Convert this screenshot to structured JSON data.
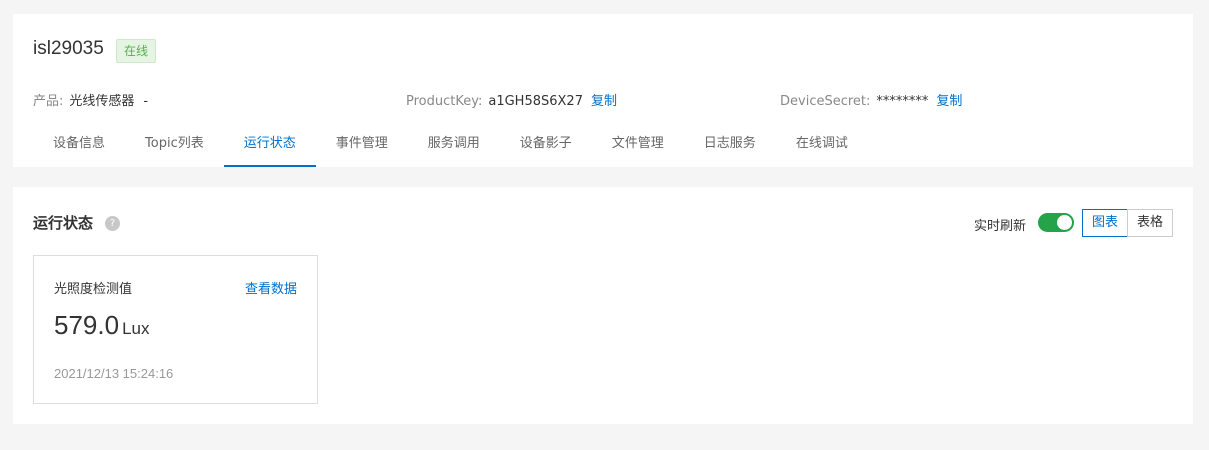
{
  "device": {
    "name": "isl29035",
    "status_badge": "在线"
  },
  "meta": {
    "product_label": "产品:",
    "product_value": "光线传感器",
    "product_dash": "-",
    "product_key_label": "ProductKey:",
    "product_key_value": "a1GH58S6X27",
    "product_key_copy": "复制",
    "device_secret_label": "DeviceSecret:",
    "device_secret_value": "********",
    "device_secret_copy": "复制"
  },
  "tabs": [
    {
      "label": "设备信息"
    },
    {
      "label": "Topic列表"
    },
    {
      "label": "运行状态",
      "active": true
    },
    {
      "label": "事件管理"
    },
    {
      "label": "服务调用"
    },
    {
      "label": "设备影子"
    },
    {
      "label": "文件管理"
    },
    {
      "label": "日志服务"
    },
    {
      "label": "在线调试"
    }
  ],
  "runtime": {
    "title": "运行状态",
    "help_icon": "question-icon",
    "help_glyph": "?",
    "realtime_refresh_label": "实时刷新",
    "realtime_refresh_on": true,
    "view_chart_label": "图表",
    "view_table_label": "表格",
    "active_view": "图表"
  },
  "card": {
    "title": "光照度检测值",
    "view_data_label": "查看数据",
    "value": "579.0",
    "unit": "Lux",
    "timestamp": "2021/12/13 15:24:16"
  },
  "colors": {
    "accent": "#0070cc",
    "online_green": "#52b04b",
    "toggle_green": "#25a24a",
    "background": "#f5f5f6"
  }
}
